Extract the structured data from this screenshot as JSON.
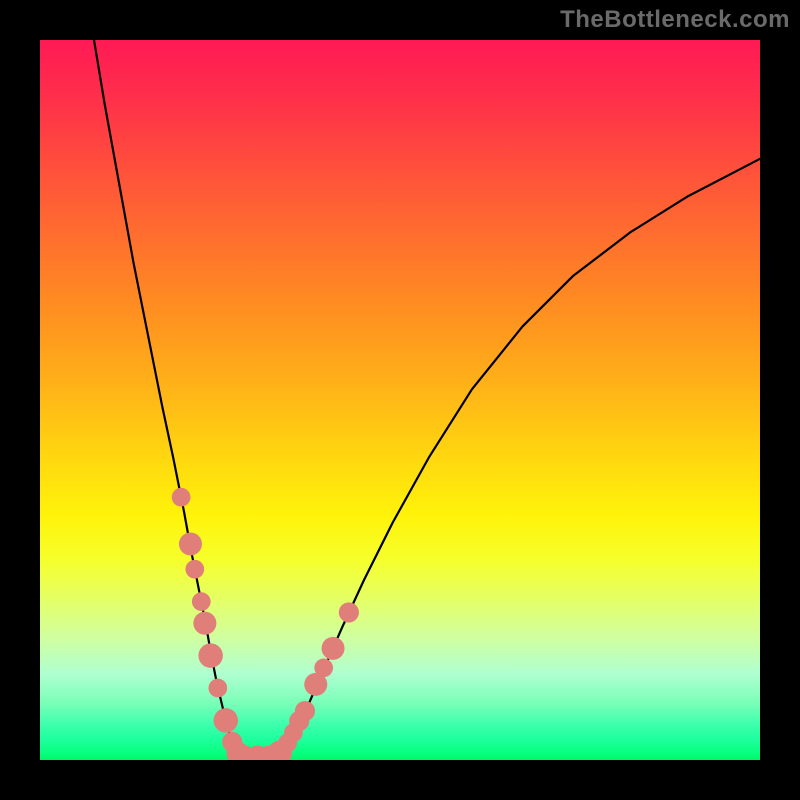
{
  "watermark_text": "TheBottleneck.com",
  "colors": {
    "page_bg": "#000000",
    "watermark_fg": "#6a6a6a",
    "curve_stroke": "#000000",
    "marker_fill": "#e07f7a",
    "gradient_top": "#ff1a55",
    "gradient_bottom": "#00f868"
  },
  "chart_data": {
    "type": "line",
    "title": "",
    "xlabel": "",
    "ylabel": "",
    "xlim": [
      0,
      100
    ],
    "ylim": [
      0,
      100
    ],
    "grid": false,
    "legend": false,
    "curves": [
      {
        "name": "left-branch",
        "x": [
          7.5,
          9,
          11,
          13,
          15,
          17,
          18.5,
          20,
          21,
          22,
          23,
          23.8,
          24.5,
          25.2,
          25.8,
          26.3,
          26.8,
          27.2,
          27.5
        ],
        "y": [
          100,
          91,
          80,
          69,
          59,
          49,
          42,
          34.5,
          29,
          24,
          19,
          14.5,
          11,
          8,
          5.5,
          3.7,
          2.3,
          1.2,
          0.5
        ]
      },
      {
        "name": "trough",
        "x": [
          27.5,
          28,
          29,
          30,
          31,
          32,
          33
        ],
        "y": [
          0.5,
          0.25,
          0.15,
          0.12,
          0.15,
          0.3,
          0.6
        ]
      },
      {
        "name": "right-branch",
        "x": [
          33,
          34,
          35,
          36,
          37.5,
          39.5,
          42,
          45,
          49,
          54,
          60,
          67,
          74,
          82,
          90,
          100
        ],
        "y": [
          0.6,
          1.5,
          3,
          5,
          8.2,
          12.8,
          18.5,
          25,
          33,
          42,
          51.5,
          60.2,
          67.2,
          73.3,
          78.3,
          83.5
        ]
      }
    ],
    "markers": [
      {
        "x": 19.6,
        "y": 36.5,
        "r": 1.3
      },
      {
        "x": 20.9,
        "y": 30.0,
        "r": 1.6
      },
      {
        "x": 21.5,
        "y": 26.5,
        "r": 1.3
      },
      {
        "x": 22.4,
        "y": 22.0,
        "r": 1.3
      },
      {
        "x": 22.9,
        "y": 19.0,
        "r": 1.6
      },
      {
        "x": 23.7,
        "y": 14.5,
        "r": 1.7
      },
      {
        "x": 24.7,
        "y": 10.0,
        "r": 1.3
      },
      {
        "x": 25.8,
        "y": 5.5,
        "r": 1.7
      },
      {
        "x": 26.7,
        "y": 2.5,
        "r": 1.4
      },
      {
        "x": 27.5,
        "y": 0.9,
        "r": 1.6
      },
      {
        "x": 28.4,
        "y": 0.4,
        "r": 1.6
      },
      {
        "x": 30.2,
        "y": 0.3,
        "r": 1.7
      },
      {
        "x": 31.8,
        "y": 0.4,
        "r": 1.6
      },
      {
        "x": 33.3,
        "y": 1.0,
        "r": 1.7
      },
      {
        "x": 34.4,
        "y": 2.4,
        "r": 1.3
      },
      {
        "x": 35.2,
        "y": 3.8,
        "r": 1.3
      },
      {
        "x": 36.0,
        "y": 5.4,
        "r": 1.4
      },
      {
        "x": 36.8,
        "y": 6.8,
        "r": 1.4
      },
      {
        "x": 38.3,
        "y": 10.5,
        "r": 1.6
      },
      {
        "x": 39.4,
        "y": 12.8,
        "r": 1.3
      },
      {
        "x": 40.7,
        "y": 15.5,
        "r": 1.6
      },
      {
        "x": 42.9,
        "y": 20.5,
        "r": 1.4
      }
    ]
  }
}
